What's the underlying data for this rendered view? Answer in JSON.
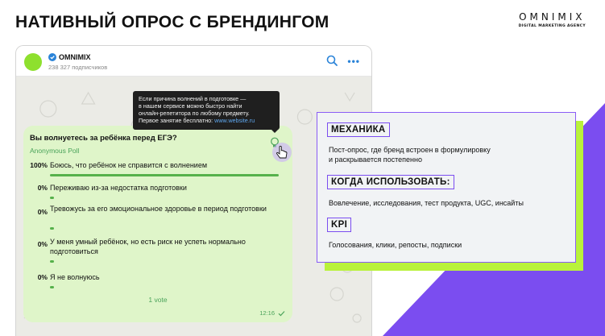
{
  "slide": {
    "title": "НАТИВНЫЙ ОПРОС С БРЕНДИНГОМ",
    "logo_wordmark": "OMNIMIX",
    "logo_tagline": "DIGITAL MARKETING AGENCY"
  },
  "channel": {
    "name": "OMNIMIX",
    "subscribers": "238 327 подписчиков"
  },
  "tooltip": {
    "line1": "Если причина волнений в подготовке —",
    "line2": "в нашем сервисе можно быстро найти",
    "line3": "онлайн-репетитора по любому предмету.",
    "line4_prefix": "Первое занятие бесплатно: ",
    "link": "www.website.ru"
  },
  "poll": {
    "question": "Вы волнуетесь за ребёнка перед ЕГЭ?",
    "type": "Anonymous Poll",
    "options": [
      {
        "percent": "100%",
        "label": "Боюсь, что ребёнок не справится с волнением",
        "share": 1.0
      },
      {
        "percent": "0%",
        "label": "Переживаю из-за недостатка подготовки",
        "share": 0
      },
      {
        "percent": "0%",
        "label": "Тревожусь за его эмоциональное здоровье в период подготовки",
        "share": 0
      },
      {
        "percent": "0%",
        "label": "У меня умный ребёнок, но есть риск не успеть нормально подготовиться",
        "share": 0
      },
      {
        "percent": "0%",
        "label": "Я не волнуюсь",
        "share": 0
      }
    ],
    "votes": "1 vote",
    "time": "12:16"
  },
  "card": {
    "mechanics_heading": "МЕХАНИКА",
    "mechanics_text1": "Пост-опрос, где бренд встроен в формулировку",
    "mechanics_text2": "и раскрывается постепенно",
    "when_heading": "КОГДА ИСПОЛЬЗОВАТЬ:",
    "when_text": "Вовлечение, исследования, тест продукта, UGC, инсайты",
    "kpi_heading": "KPI",
    "kpi_text": "Голосования, клики, репосты, подписки"
  },
  "colors": {
    "accent_purple": "#7b4df0",
    "accent_lime": "#b9f23b",
    "poll_bubble": "#dff5c9",
    "poll_green": "#56b14b",
    "telegram_blue": "#2a83d8"
  }
}
